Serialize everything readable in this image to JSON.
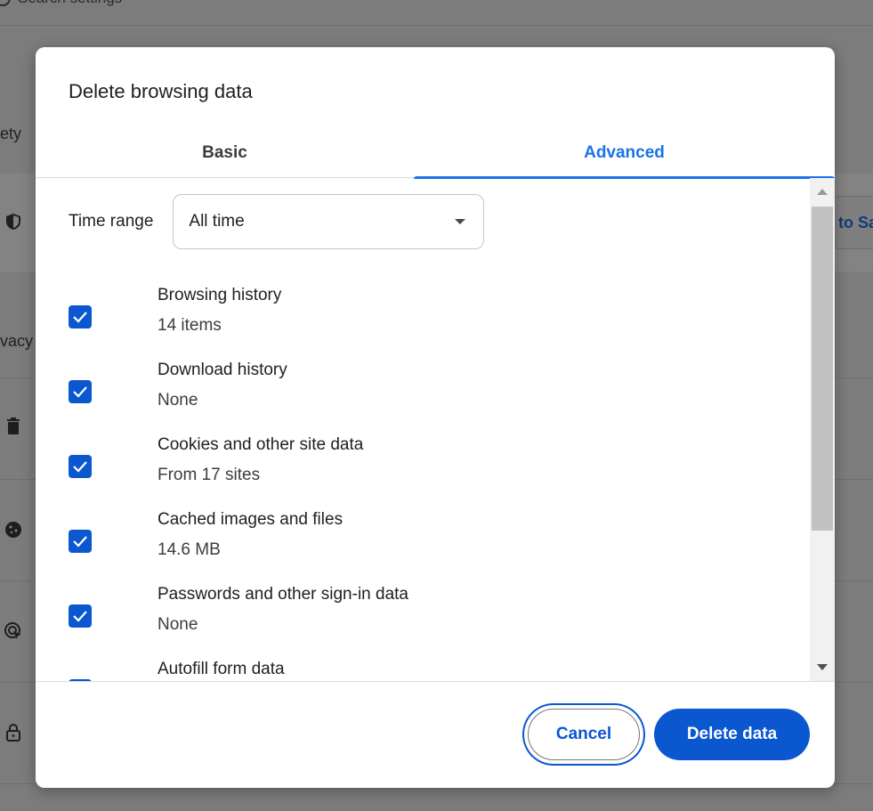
{
  "background": {
    "search_placeholder": "Search settings",
    "fragment_safety": "ety",
    "fragment_privacy": "vacy",
    "fragment_button": "to Sa"
  },
  "dialog": {
    "title": "Delete browsing data",
    "tabs": [
      {
        "label": "Basic",
        "selected": false
      },
      {
        "label": "Advanced",
        "selected": true
      }
    ],
    "time_range": {
      "label": "Time range",
      "value": "All time"
    },
    "items": [
      {
        "title": "Browsing history",
        "subtitle": "14 items",
        "checked": true
      },
      {
        "title": "Download history",
        "subtitle": "None",
        "checked": true
      },
      {
        "title": "Cookies and other site data",
        "subtitle": "From 17 sites",
        "checked": true
      },
      {
        "title": "Cached images and files",
        "subtitle": "14.6 MB",
        "checked": true
      },
      {
        "title": "Passwords and other sign-in data",
        "subtitle": "None",
        "checked": true
      },
      {
        "title": "Autofill form data",
        "subtitle": "",
        "checked": true
      }
    ],
    "buttons": {
      "cancel": "Cancel",
      "delete": "Delete data"
    }
  },
  "colors": {
    "accent": "#0b57d0",
    "tab_active": "#1a73e8",
    "overlay": "#7c7c7c"
  }
}
